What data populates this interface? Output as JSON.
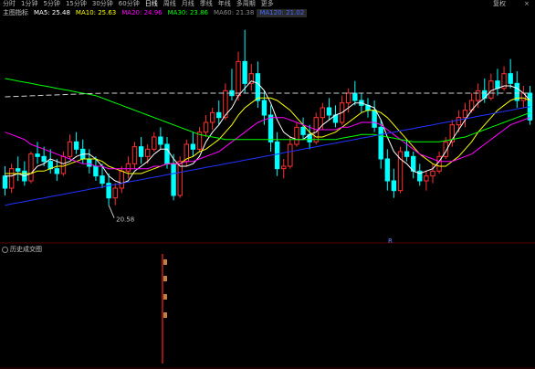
{
  "toolbar": {
    "items": [
      "分时",
      "1分钟",
      "5分钟",
      "15分钟",
      "30分钟",
      "60分钟",
      "日线",
      "周线",
      "月线",
      "季线",
      "年线",
      "多周期",
      "更多"
    ],
    "active_index": 6,
    "right_label": "复权",
    "close_label": "×"
  },
  "infobar": {
    "title": "主图指标",
    "ma_items": [
      {
        "label": "MA5: 25.48",
        "color": "#ffffff"
      },
      {
        "label": "MA10: 25.63",
        "color": "#ffff00"
      },
      {
        "label": "MA20: 24.96",
        "color": "#ff00ff"
      },
      {
        "label": "MA30: 23.86",
        "color": "#00ff00"
      },
      {
        "label": "MA60: 21.38",
        "color": "#888888"
      },
      {
        "label": "MA120: 21.02",
        "color": "#2222ff"
      }
    ]
  },
  "chart_data": {
    "type": "candlestick",
    "title": "",
    "ylim": [
      19.2,
      28.2
    ],
    "up_color": "#ff3030",
    "down_color": "#00ffff",
    "candles": [
      [
        21.8,
        22.2,
        21.0,
        21.3
      ],
      [
        21.3,
        22.3,
        21.1,
        22.1
      ],
      [
        22.1,
        22.6,
        21.6,
        22.0
      ],
      [
        22.0,
        22.4,
        21.4,
        21.6
      ],
      [
        21.6,
        22.8,
        21.5,
        22.7
      ],
      [
        22.7,
        23.2,
        22.3,
        22.6
      ],
      [
        22.6,
        23.0,
        22.2,
        22.4
      ],
      [
        22.4,
        22.9,
        21.9,
        22.1
      ],
      [
        22.1,
        22.5,
        21.6,
        21.9
      ],
      [
        21.9,
        22.8,
        21.8,
        22.6
      ],
      [
        22.6,
        23.5,
        22.5,
        23.2
      ],
      [
        23.2,
        23.6,
        22.7,
        22.9
      ],
      [
        22.9,
        23.3,
        22.3,
        22.5
      ],
      [
        22.5,
        22.9,
        21.9,
        22.2
      ],
      [
        22.2,
        22.6,
        21.6,
        21.8
      ],
      [
        21.8,
        22.3,
        21.3,
        21.5
      ],
      [
        21.5,
        21.9,
        20.6,
        20.9
      ],
      [
        20.9,
        21.5,
        20.6,
        21.3
      ],
      [
        21.3,
        22.2,
        21.1,
        22.0
      ],
      [
        22.0,
        22.6,
        21.7,
        22.3
      ],
      [
        22.3,
        23.2,
        22.1,
        23.0
      ],
      [
        23.0,
        23.4,
        22.3,
        22.6
      ],
      [
        22.6,
        23.1,
        22.3,
        22.9
      ],
      [
        22.9,
        23.6,
        22.8,
        23.4
      ],
      [
        23.4,
        23.8,
        22.9,
        23.1
      ],
      [
        23.1,
        23.4,
        22.1,
        22.3
      ],
      [
        22.3,
        22.7,
        20.8,
        21.0
      ],
      [
        21.0,
        22.6,
        20.9,
        22.4
      ],
      [
        22.4,
        23.3,
        22.2,
        23.1
      ],
      [
        23.1,
        23.6,
        22.6,
        22.9
      ],
      [
        22.9,
        23.8,
        22.8,
        23.6
      ],
      [
        23.6,
        24.3,
        23.4,
        24.0
      ],
      [
        24.0,
        24.6,
        23.7,
        24.4
      ],
      [
        24.4,
        24.9,
        23.9,
        24.2
      ],
      [
        24.2,
        25.6,
        24.1,
        25.3
      ],
      [
        25.3,
        26.2,
        24.9,
        25.1
      ],
      [
        25.1,
        26.9,
        24.9,
        26.5
      ],
      [
        26.5,
        27.8,
        25.2,
        25.6
      ],
      [
        25.6,
        26.4,
        25.3,
        26.0
      ],
      [
        26.0,
        26.5,
        24.6,
        24.9
      ],
      [
        24.9,
        25.3,
        23.9,
        24.3
      ],
      [
        24.3,
        24.7,
        22.8,
        23.2
      ],
      [
        23.2,
        23.6,
        21.8,
        22.1
      ],
      [
        22.1,
        22.5,
        21.7,
        22.2
      ],
      [
        22.2,
        23.4,
        22.1,
        23.1
      ],
      [
        23.1,
        24.0,
        23.0,
        23.8
      ],
      [
        23.8,
        24.2,
        23.3,
        23.5
      ],
      [
        23.5,
        23.9,
        22.9,
        23.2
      ],
      [
        23.2,
        24.4,
        23.1,
        24.2
      ],
      [
        24.2,
        24.8,
        23.7,
        24.6
      ],
      [
        24.6,
        25.0,
        24.1,
        24.3
      ],
      [
        24.3,
        24.7,
        23.8,
        24.0
      ],
      [
        24.0,
        25.1,
        23.9,
        24.8
      ],
      [
        24.8,
        25.4,
        24.4,
        25.2
      ],
      [
        25.2,
        25.7,
        24.7,
        24.9
      ],
      [
        24.9,
        25.2,
        24.4,
        24.7
      ],
      [
        24.7,
        25.0,
        24.2,
        24.5
      ],
      [
        24.5,
        24.9,
        23.6,
        23.8
      ],
      [
        23.8,
        24.1,
        22.1,
        22.5
      ],
      [
        22.5,
        22.9,
        21.2,
        21.6
      ],
      [
        21.6,
        22.1,
        20.9,
        21.2
      ],
      [
        21.2,
        23.0,
        21.1,
        22.8
      ],
      [
        22.8,
        23.3,
        22.4,
        22.6
      ],
      [
        22.6,
        22.8,
        21.7,
        22.0
      ],
      [
        22.0,
        22.3,
        21.4,
        21.6
      ],
      [
        21.6,
        22.0,
        21.2,
        21.8
      ],
      [
        21.8,
        22.3,
        21.5,
        22.0
      ],
      [
        22.0,
        22.8,
        21.9,
        22.6
      ],
      [
        22.6,
        23.4,
        22.5,
        23.2
      ],
      [
        23.2,
        24.1,
        23.0,
        23.9
      ],
      [
        23.9,
        24.5,
        23.6,
        24.2
      ],
      [
        24.2,
        24.8,
        23.8,
        24.5
      ],
      [
        24.5,
        25.2,
        24.4,
        24.9
      ],
      [
        24.9,
        25.6,
        24.6,
        25.3
      ],
      [
        25.3,
        25.8,
        24.8,
        25.0
      ],
      [
        25.0,
        26.0,
        24.9,
        25.7
      ],
      [
        25.7,
        26.2,
        25.1,
        25.4
      ],
      [
        25.4,
        26.3,
        25.3,
        26.0
      ],
      [
        26.0,
        26.6,
        25.4,
        25.6
      ],
      [
        25.6,
        26.1,
        24.6,
        24.9
      ],
      [
        24.9,
        25.5,
        24.6,
        25.2
      ],
      [
        25.2,
        25.5,
        23.9,
        24.1
      ]
    ],
    "ma_lines": [
      {
        "name": "MA5",
        "color": "#ffffff",
        "values": [
          21.8,
          21.8,
          21.9,
          21.8,
          21.9,
          22.2,
          22.3,
          22.5,
          22.4,
          22.3,
          22.4,
          22.6,
          22.7,
          22.7,
          22.5,
          22.2,
          21.8,
          21.6,
          21.5,
          21.6,
          22.0,
          22.2,
          22.4,
          22.7,
          22.9,
          22.9,
          22.5,
          22.2,
          22.2,
          22.3,
          22.6,
          23.2,
          23.6,
          23.9,
          24.3,
          24.6,
          25.1,
          25.4,
          25.7,
          25.6,
          25.3,
          24.8,
          24.1,
          23.6,
          23.4,
          23.3,
          23.3,
          23.5,
          23.6,
          23.9,
          24.1,
          24.3,
          24.4,
          24.6,
          24.8,
          24.8,
          24.7,
          24.6,
          24.1,
          23.4,
          22.8,
          22.5,
          22.3,
          22.0,
          21.9,
          22.0,
          22.1,
          22.4,
          22.8,
          23.3,
          23.7,
          24.1,
          24.5,
          24.8,
          25.0,
          25.3,
          25.4,
          25.5,
          25.5,
          25.4,
          25.2,
          24.9
        ]
      },
      {
        "name": "MA10",
        "color": "#ffff00",
        "values": [
          21.9,
          21.9,
          21.9,
          21.9,
          21.9,
          22.0,
          22.0,
          22.1,
          22.2,
          22.2,
          22.3,
          22.4,
          22.5,
          22.5,
          22.5,
          22.4,
          22.2,
          22.1,
          22.0,
          21.9,
          21.9,
          21.9,
          22.0,
          22.1,
          22.2,
          22.3,
          22.3,
          22.3,
          22.5,
          22.6,
          22.8,
          22.9,
          23.1,
          23.3,
          23.6,
          23.9,
          24.3,
          24.6,
          24.8,
          25.0,
          25.0,
          25.0,
          24.9,
          24.7,
          24.5,
          24.2,
          23.9,
          23.6,
          23.4,
          23.4,
          23.5,
          23.6,
          23.8,
          24.0,
          24.2,
          24.4,
          24.5,
          24.5,
          24.4,
          24.2,
          23.9,
          23.6,
          23.3,
          23.0,
          22.7,
          22.5,
          22.3,
          22.2,
          22.2,
          22.4,
          22.6,
          22.9,
          23.2,
          23.6,
          23.9,
          24.2,
          24.5,
          24.7,
          24.9,
          25.0,
          25.0,
          24.9
        ]
      },
      {
        "name": "MA20",
        "color": "#ff00ff",
        "values": [
          23.6,
          23.5,
          23.4,
          23.3,
          23.1,
          23.0,
          22.9,
          22.8,
          22.7,
          22.6,
          22.5,
          22.4,
          22.3,
          22.3,
          22.2,
          22.2,
          22.1,
          22.1,
          22.1,
          22.1,
          22.1,
          22.1,
          22.1,
          22.2,
          22.2,
          22.3,
          22.3,
          22.3,
          22.4,
          22.4,
          22.5,
          22.6,
          22.7,
          22.8,
          23.0,
          23.2,
          23.4,
          23.6,
          23.8,
          24.0,
          24.1,
          24.2,
          24.2,
          24.2,
          24.1,
          24.0,
          23.9,
          23.8,
          23.7,
          23.7,
          23.7,
          23.7,
          23.8,
          23.8,
          23.9,
          24.0,
          24.0,
          24.0,
          23.9,
          23.7,
          23.5,
          23.3,
          23.1,
          22.9,
          22.7,
          22.6,
          22.5,
          22.4,
          22.4,
          22.4,
          22.5,
          22.6,
          22.7,
          22.9,
          23.1,
          23.3,
          23.5,
          23.7,
          23.9,
          24.0,
          24.1,
          24.2
        ]
      },
      {
        "name": "MA30",
        "color": "#00ff00",
        "values": [
          25.8,
          25.75,
          25.7,
          25.65,
          25.6,
          25.55,
          25.5,
          25.45,
          25.4,
          25.35,
          25.3,
          25.25,
          25.2,
          25.15,
          25.1,
          25.0,
          24.9,
          24.8,
          24.7,
          24.6,
          24.5,
          24.4,
          24.3,
          24.2,
          24.1,
          24.0,
          23.9,
          23.8,
          23.7,
          23.6,
          23.5,
          23.45,
          23.4,
          23.35,
          23.3,
          23.3,
          23.3,
          23.3,
          23.3,
          23.3,
          23.3,
          23.3,
          23.3,
          23.3,
          23.3,
          23.3,
          23.3,
          23.3,
          23.3,
          23.3,
          23.3,
          23.3,
          23.35,
          23.4,
          23.45,
          23.5,
          23.5,
          23.5,
          23.45,
          23.4,
          23.35,
          23.3,
          23.25,
          23.2,
          23.2,
          23.2,
          23.2,
          23.2,
          23.25,
          23.3,
          23.35,
          23.4,
          23.5,
          23.6,
          23.7,
          23.8,
          23.9,
          24.0,
          24.1,
          24.2,
          24.3,
          24.4
        ]
      },
      {
        "name": "MA60",
        "color": "#cfcfcf",
        "dashed": true,
        "values": [
          25.05,
          25.06,
          25.07,
          25.08,
          25.09,
          25.1,
          25.11,
          25.12,
          25.13,
          25.14,
          25.15,
          25.16,
          25.17,
          25.18,
          25.19,
          25.2,
          25.2,
          25.2,
          25.2,
          25.2,
          25.2,
          25.2,
          25.2,
          25.2,
          25.2,
          25.2,
          25.2,
          25.2,
          25.2,
          25.2,
          25.2,
          25.2,
          25.2,
          25.2,
          25.2,
          25.2,
          25.2,
          25.2,
          25.2,
          25.2,
          25.2,
          25.2,
          25.2,
          25.2,
          25.2,
          25.2,
          25.2,
          25.2,
          25.2,
          25.2,
          25.2,
          25.2,
          25.2,
          25.2,
          25.2,
          25.2,
          25.2,
          25.2,
          25.2,
          25.2,
          25.2,
          25.2,
          25.2,
          25.2,
          25.2,
          25.2,
          25.2,
          25.2,
          25.2,
          25.2,
          25.2,
          25.2,
          25.2,
          25.2,
          25.2,
          25.2,
          25.2,
          25.2,
          25.2,
          25.2,
          25.2,
          25.2
        ]
      },
      {
        "name": "MA120",
        "color": "#2233ff",
        "values": [
          20.6,
          20.65,
          20.7,
          20.75,
          20.8,
          20.85,
          20.9,
          20.95,
          21.0,
          21.05,
          21.1,
          21.15,
          21.2,
          21.25,
          21.3,
          21.35,
          21.4,
          21.45,
          21.5,
          21.55,
          21.6,
          21.65,
          21.7,
          21.75,
          21.8,
          21.85,
          21.9,
          21.95,
          22.0,
          22.05,
          22.1,
          22.15,
          22.2,
          22.25,
          22.3,
          22.35,
          22.4,
          22.45,
          22.5,
          22.55,
          22.6,
          22.65,
          22.7,
          22.75,
          22.8,
          22.85,
          22.9,
          22.95,
          23.0,
          23.05,
          23.1,
          23.15,
          23.2,
          23.25,
          23.3,
          23.35,
          23.4,
          23.45,
          23.5,
          23.55,
          23.6,
          23.65,
          23.7,
          23.75,
          23.8,
          23.85,
          23.9,
          23.95,
          24.0,
          24.05,
          24.1,
          24.15,
          24.2,
          24.25,
          24.3,
          24.35,
          24.4,
          24.45,
          24.5,
          24.55,
          24.6,
          24.65
        ]
      }
    ],
    "low_annotation": {
      "index": 16,
      "label": "20.58"
    },
    "sub_panel": {
      "title": "历史成交图",
      "marker_label": "R"
    }
  }
}
